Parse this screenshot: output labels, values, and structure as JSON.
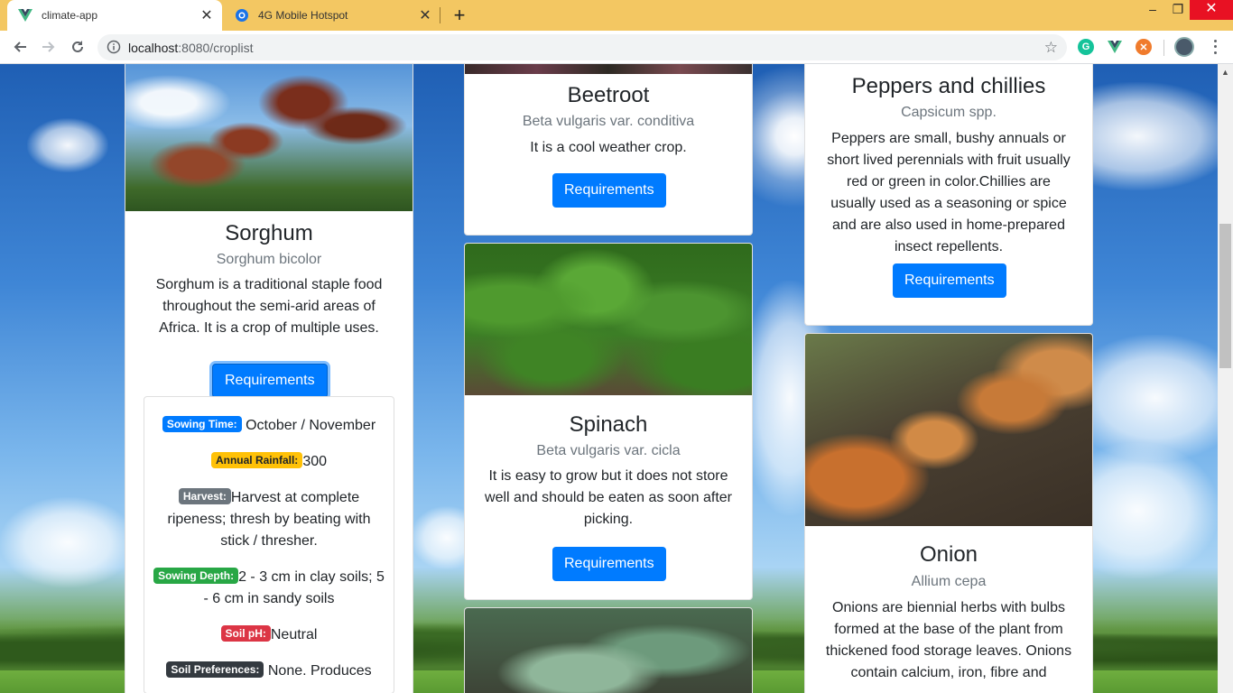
{
  "browser": {
    "tabs": [
      {
        "title": "climate-app",
        "active": true
      },
      {
        "title": "4G Mobile Hotspot",
        "active": false
      }
    ],
    "url_host": "localhost",
    "url_path": ":8080/croplist",
    "colors": {
      "tabbar": "#f3c762",
      "close_button": "#e81123"
    }
  },
  "crops": {
    "sorghum": {
      "name": "Sorghum",
      "scientific": "Sorghum bicolor",
      "description": "Sorghum is a traditional staple food throughout the semi-arid areas of Africa. It is a crop of multiple uses.",
      "button": "Requirements",
      "requirements": {
        "sowing_time_label": "Sowing Time:",
        "sowing_time": "October / November",
        "rainfall_label": "Annual Rainfall:",
        "rainfall": "300",
        "harvest_label": "Harvest:",
        "harvest": "Harvest at complete ripeness; thresh by beating with stick / thresher.",
        "sowing_depth_label": "Sowing Depth:",
        "sowing_depth": "2 - 3 cm in clay soils; 5 - 6 cm in sandy soils",
        "soil_ph_label": "Soil pH:",
        "soil_ph": "Neutral",
        "soil_pref_label": "Soil Preferences:",
        "soil_pref": "None. Produces"
      }
    },
    "beetroot": {
      "name": "Beetroot",
      "scientific": "Beta vulgaris var. conditiva",
      "description": "It is a cool weather crop.",
      "button": "Requirements"
    },
    "spinach": {
      "name": "Spinach",
      "scientific": "Beta vulgaris var. cicla",
      "description": "It is easy to grow but it does not store well and should be eaten as soon after picking.",
      "button": "Requirements"
    },
    "peppers": {
      "name": "Peppers and chillies",
      "scientific": "Capsicum spp.",
      "description": "Peppers are small, bushy annuals or short lived perennials with fruit usually red or green in color.Chillies are usually used as a seasoning or spice and are also used in home-prepared insect repellents.",
      "button": "Requirements"
    },
    "onion": {
      "name": "Onion",
      "scientific": "Allium cepa",
      "description": "Onions are biennial herbs with bulbs formed at the base of the plant from thickened food storage leaves. Onions contain calcium, iron, fibre and"
    }
  },
  "colors": {
    "primary": "#007bff"
  }
}
